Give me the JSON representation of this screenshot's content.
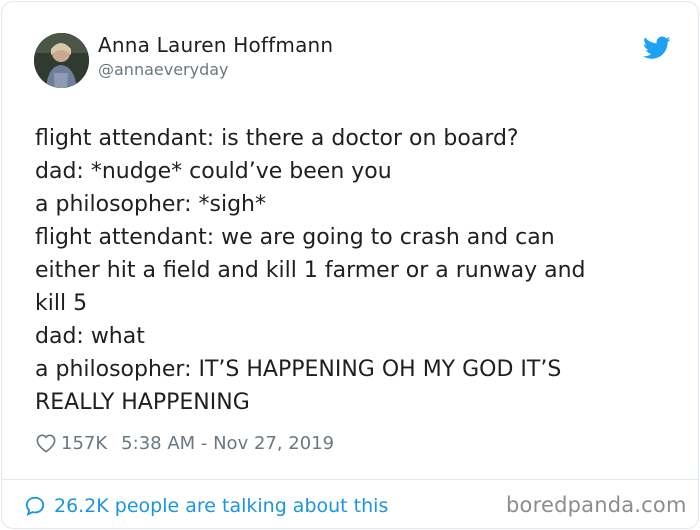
{
  "author": {
    "name": "Anna Lauren Hoffmann",
    "handle": "@annaeveryday"
  },
  "tweet": {
    "lines": [
      "flight attendant: is there a doctor on board?",
      "dad: *nudge* could’ve been you",
      "a philosopher: *sigh*",
      "flight attendant: we are going to crash and can",
      "either hit a field and kill 1 farmer or a runway and",
      "kill 5",
      "dad: what",
      "a philosopher: IT’S HAPPENING OH MY GOD IT’S",
      "REALLY HAPPENING"
    ]
  },
  "meta": {
    "likes": "157K",
    "timestamp": "5:38 AM - Nov 27, 2019"
  },
  "footer": {
    "talking": "26.2K people are talking about this",
    "watermark": "boredpanda.com"
  },
  "icons": {
    "brand": "twitter-bird-icon",
    "like": "heart-icon",
    "talk": "speech-bubble-icon"
  },
  "colors": {
    "twitter_blue": "#1da1f2",
    "link_blue": "#1b95e0",
    "muted_text": "#697882",
    "body_text": "#1c2022"
  }
}
